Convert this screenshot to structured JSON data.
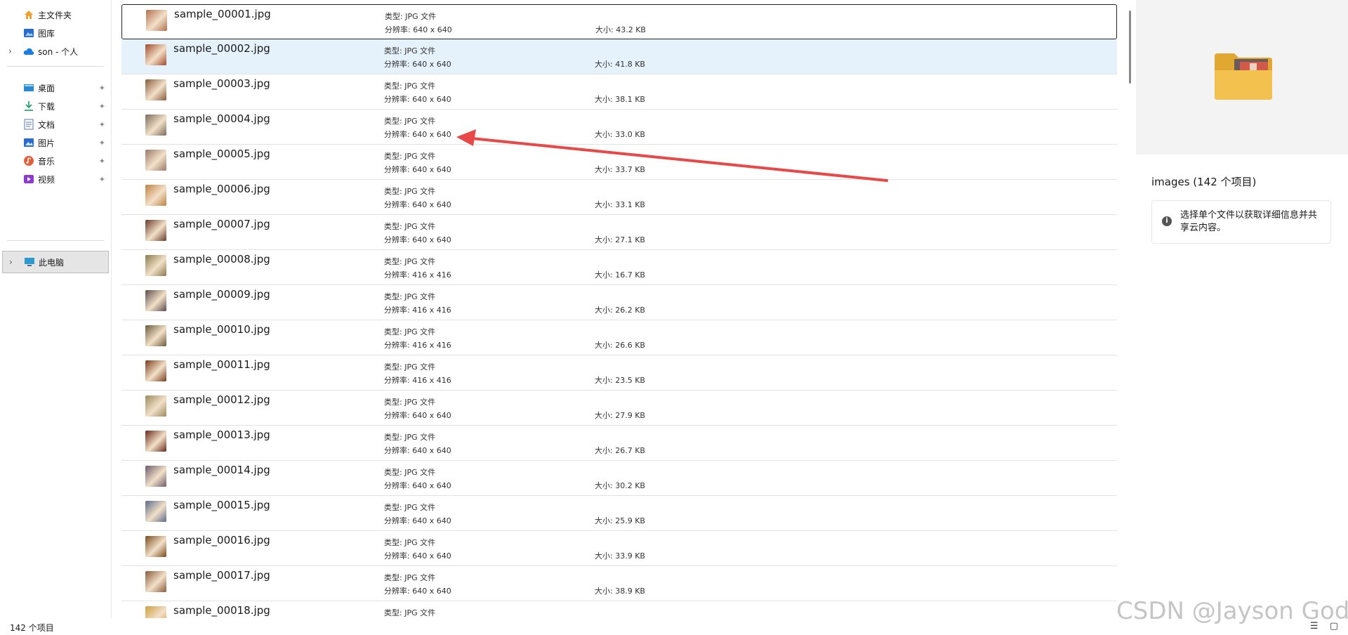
{
  "sidebar": {
    "items": [
      {
        "label": "主文件夹",
        "icon": "home-icon",
        "pinned": false,
        "expandable": false
      },
      {
        "label": "图库",
        "icon": "gallery-icon",
        "pinned": false,
        "expandable": false
      },
      {
        "label": "son - 个人",
        "icon": "cloud-icon",
        "pinned": false,
        "expandable": true
      },
      {
        "label": "桌面",
        "icon": "desktop-icon",
        "pinned": true,
        "expandable": false
      },
      {
        "label": "下载",
        "icon": "download-icon",
        "pinned": true,
        "expandable": false
      },
      {
        "label": "文档",
        "icon": "document-icon",
        "pinned": true,
        "expandable": false
      },
      {
        "label": "图片",
        "icon": "pictures-icon",
        "pinned": true,
        "expandable": false
      },
      {
        "label": "音乐",
        "icon": "music-icon",
        "pinned": true,
        "expandable": false
      },
      {
        "label": "视频",
        "icon": "video-icon",
        "pinned": true,
        "expandable": false
      },
      {
        "label": "此电脑",
        "icon": "computer-icon",
        "pinned": false,
        "expandable": true,
        "selected": true
      }
    ],
    "pin_glyph": "📌"
  },
  "files": [
    {
      "name": "sample_00001.jpg",
      "type": "类型: JPG 文件",
      "res": "分辨率: 640 x 640",
      "size": "大小: 43.2 KB",
      "thumb": "#b07050"
    },
    {
      "name": "sample_00002.jpg",
      "type": "类型: JPG 文件",
      "res": "分辨率: 640 x 640",
      "size": "大小: 41.8 KB",
      "thumb": "#a04a2a"
    },
    {
      "name": "sample_00003.jpg",
      "type": "类型: JPG 文件",
      "res": "分辨率: 640 x 640",
      "size": "大小: 38.1 KB",
      "thumb": "#8a5a3c"
    },
    {
      "name": "sample_00004.jpg",
      "type": "类型: JPG 文件",
      "res": "分辨率: 640 x 640",
      "size": "大小: 33.0 KB",
      "thumb": "#7a6a5a"
    },
    {
      "name": "sample_00005.jpg",
      "type": "类型: JPG 文件",
      "res": "分辨率: 640 x 640",
      "size": "大小: 33.7 KB",
      "thumb": "#9a7a6a"
    },
    {
      "name": "sample_00006.jpg",
      "type": "类型: JPG 文件",
      "res": "分辨率: 640 x 640",
      "size": "大小: 33.1 KB",
      "thumb": "#c08040"
    },
    {
      "name": "sample_00007.jpg",
      "type": "类型: JPG 文件",
      "res": "分辨率: 640 x 640",
      "size": "大小: 27.1 KB",
      "thumb": "#6a3a2a"
    },
    {
      "name": "sample_00008.jpg",
      "type": "类型: JPG 文件",
      "res": "分辨率: 416 x 416",
      "size": "大小: 16.7 KB",
      "thumb": "#8a7a4a"
    },
    {
      "name": "sample_00009.jpg",
      "type": "类型: JPG 文件",
      "res": "分辨率: 416 x 416",
      "size": "大小: 26.2 KB",
      "thumb": "#5a4a4a"
    },
    {
      "name": "sample_00010.jpg",
      "type": "类型: JPG 文件",
      "res": "分辨率: 416 x 416",
      "size": "大小: 26.6 KB",
      "thumb": "#6a5a3a"
    },
    {
      "name": "sample_00011.jpg",
      "type": "类型: JPG 文件",
      "res": "分辨率: 416 x 416",
      "size": "大小: 23.5 KB",
      "thumb": "#7a3a1a"
    },
    {
      "name": "sample_00012.jpg",
      "type": "类型: JPG 文件",
      "res": "分辨率: 640 x 640",
      "size": "大小: 27.9 KB",
      "thumb": "#9a8a5a"
    },
    {
      "name": "sample_00013.jpg",
      "type": "类型: JPG 文件",
      "res": "分辨率: 640 x 640",
      "size": "大小: 26.7 KB",
      "thumb": "#6a2a1a"
    },
    {
      "name": "sample_00014.jpg",
      "type": "类型: JPG 文件",
      "res": "分辨率: 640 x 640",
      "size": "大小: 30.2 KB",
      "thumb": "#6a5a6a"
    },
    {
      "name": "sample_00015.jpg",
      "type": "类型: JPG 文件",
      "res": "分辨率: 640 x 640",
      "size": "大小: 25.9 KB",
      "thumb": "#5a6a8a"
    },
    {
      "name": "sample_00016.jpg",
      "type": "类型: JPG 文件",
      "res": "分辨率: 640 x 640",
      "size": "大小: 33.9 KB",
      "thumb": "#7a4a1a"
    },
    {
      "name": "sample_00017.jpg",
      "type": "类型: JPG 文件",
      "res": "分辨率: 640 x 640",
      "size": "大小: 38.9 KB",
      "thumb": "#8a5a3a"
    },
    {
      "name": "sample_00018.jpg",
      "type": "类型: JPG 文件",
      "res": "",
      "size": "",
      "thumb": "#d0a040"
    }
  ],
  "details": {
    "title": "images (142 个项目)",
    "info": "选择单个文件以获取详细信息并共享云内容。",
    "info_icon_glyph": "i"
  },
  "status": {
    "count": "142 个项目",
    "view_glyphs": "☰ ▢"
  },
  "watermark": "CSDN @Jayson God",
  "colors": {
    "selected_row": "#e5f1fb",
    "annotation_arrow": "#e84848",
    "folder_yellow": "#f2c14e"
  }
}
